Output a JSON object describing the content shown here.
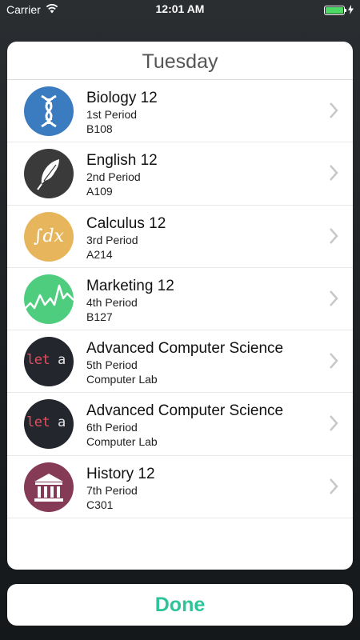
{
  "status_bar": {
    "carrier": "Carrier",
    "time": "12:01 AM",
    "battery_level": 1.0
  },
  "sheet": {
    "title": "Tuesday"
  },
  "classes": [
    {
      "name": "Biology 12",
      "period": "1st Period",
      "room": "B108",
      "icon": "dna-icon",
      "icon_bg": "#3a7cbf"
    },
    {
      "name": "English 12",
      "period": "2nd Period",
      "room": "A109",
      "icon": "quill-feather-icon",
      "icon_bg": "#3a3a3a"
    },
    {
      "name": "Calculus 12",
      "period": "3rd Period",
      "room": "A214",
      "icon": "integral-icon",
      "icon_bg": "#e7b65c",
      "icon_text": "∫dx"
    },
    {
      "name": "Marketing 12",
      "period": "4th Period",
      "room": "B127",
      "icon": "line-graph-icon",
      "icon_bg": "#4fcd7f"
    },
    {
      "name": "Advanced Computer Science",
      "period": "5th Period",
      "room": "Computer Lab",
      "icon": "code-icon",
      "icon_bg": "#23262d",
      "icon_text_a": "let",
      "icon_text_b": "a",
      "icon_text_c": "="
    },
    {
      "name": "Advanced Computer Science",
      "period": "6th Period",
      "room": "Computer Lab",
      "icon": "code-icon",
      "icon_bg": "#23262d",
      "icon_text_a": "let",
      "icon_text_b": "a",
      "icon_text_c": "="
    },
    {
      "name": "History 12",
      "period": "7th Period",
      "room": "C301",
      "icon": "museum-columns-icon",
      "icon_bg": "#853b56"
    }
  ],
  "done_label": "Done",
  "colors": {
    "accent": "#2ec49a",
    "chevron": "#c7c7cc"
  }
}
